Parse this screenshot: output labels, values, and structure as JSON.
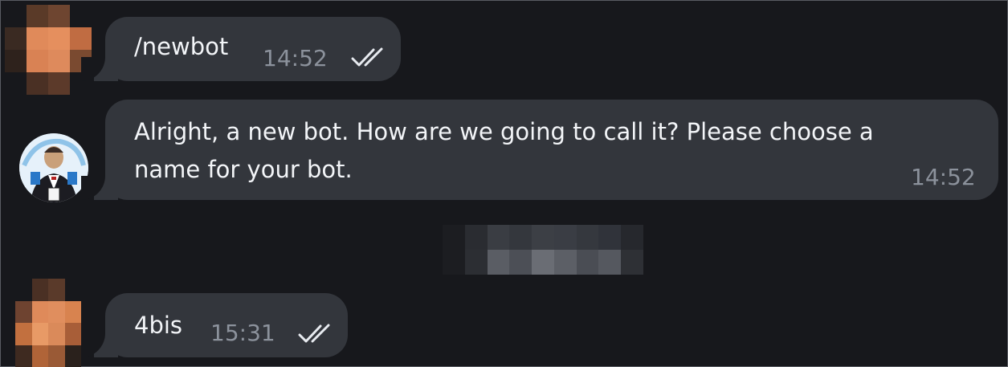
{
  "messages": [
    {
      "text": "/newbot",
      "time": "14:52",
      "status": "read"
    },
    {
      "text_line1": "Alright, a new bot. How are we going to call it? Please choose a",
      "text_line2": "name for your bot.",
      "time": "14:52"
    },
    {
      "text": "4bis",
      "time": "15:31",
      "status": "read"
    }
  ],
  "icons": {
    "read_receipt": "double-check-icon",
    "user_avatar": "pixelated-avatar",
    "bot_avatar": "botfather-avatar"
  },
  "colors": {
    "background": "#17181c",
    "bubble": "#33363c",
    "text": "#f3f5f8",
    "timestamp": "#8c929c"
  }
}
